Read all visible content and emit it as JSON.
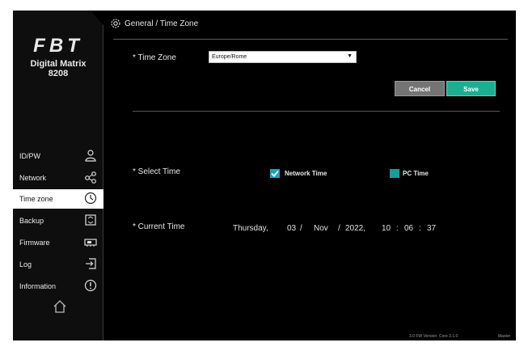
{
  "logo": {
    "mark": "FBT",
    "model_line1": "Digital Matrix",
    "model_line2": "8208"
  },
  "header": {
    "breadcrumb": "General / Time Zone"
  },
  "sidebar": {
    "items": [
      {
        "label": "ID/PW",
        "icon": "user-icon"
      },
      {
        "label": "Network",
        "icon": "network-icon"
      },
      {
        "label": "Time zone",
        "icon": "clock-icon",
        "active": true
      },
      {
        "label": "Backup",
        "icon": "backup-icon"
      },
      {
        "label": "Firmware",
        "icon": "firmware-icon"
      },
      {
        "label": "Log",
        "icon": "log-icon"
      },
      {
        "label": "Information",
        "icon": "info-icon"
      }
    ],
    "home_icon": "home-icon"
  },
  "timezone": {
    "label": "* Time Zone",
    "selected": "Europe/Rome"
  },
  "buttons": {
    "cancel": "Cancel",
    "save": "Save"
  },
  "select_time": {
    "label": "* Select Time",
    "network_label": "Network Time",
    "network_checked": true,
    "pc_label": "PC Time",
    "pc_checked": false
  },
  "current_time": {
    "label": "* Current Time",
    "weekday": "Thursday,",
    "day": "03",
    "sep1": "/",
    "month": "Nov",
    "sep2": "/",
    "year": "2022,",
    "hour": "10",
    "sep3": ":",
    "minute": "06",
    "sep4": ":",
    "second": "37"
  },
  "footer": {
    "version": "3.0 FW Version: Core 3.1.0",
    "mode": "Master"
  },
  "colors": {
    "accent": "#1aaf90",
    "checkbox": "#1aa0c6",
    "background": "#000000"
  }
}
